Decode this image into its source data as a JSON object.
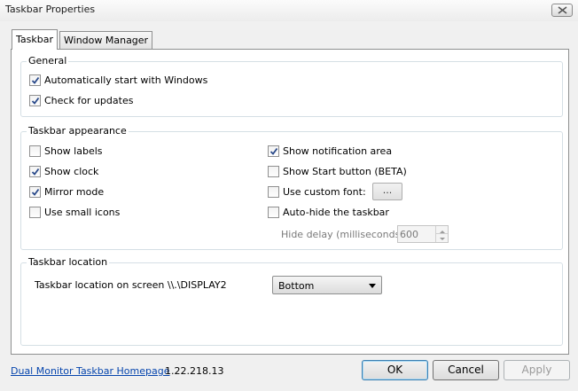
{
  "window": {
    "title": "Taskbar Properties"
  },
  "tabs": [
    {
      "label": "Taskbar",
      "active": true
    },
    {
      "label": "Window Manager",
      "active": false
    }
  ],
  "general": {
    "title": "General",
    "options": [
      {
        "label": "Automatically start with Windows",
        "checked": true
      },
      {
        "label": "Check for updates",
        "checked": true
      }
    ]
  },
  "appearance": {
    "title": "Taskbar appearance",
    "left_options": [
      {
        "label": "Show labels",
        "checked": false
      },
      {
        "label": "Show clock",
        "checked": true
      },
      {
        "label": "Mirror mode",
        "checked": true
      },
      {
        "label": "Use small icons",
        "checked": false
      }
    ],
    "right_options": [
      {
        "label": "Show notification area",
        "checked": true
      },
      {
        "label": "Show Start button (BETA)",
        "checked": false
      },
      {
        "label": "Use custom font:",
        "checked": false
      },
      {
        "label": "Auto-hide the taskbar",
        "checked": false
      }
    ],
    "font_button_label": "...",
    "hide_delay_label": "Hide delay (milliseconds):",
    "hide_delay_value": "600"
  },
  "location": {
    "title": "Taskbar location",
    "label": "Taskbar location on screen \\\\.\\DISPLAY2",
    "selected": "Bottom"
  },
  "footer": {
    "homepage_link": "Dual Monitor Taskbar Homepage",
    "version": "1.22.218.13",
    "ok_label": "OK",
    "cancel_label": "Cancel",
    "apply_label": "Apply"
  }
}
